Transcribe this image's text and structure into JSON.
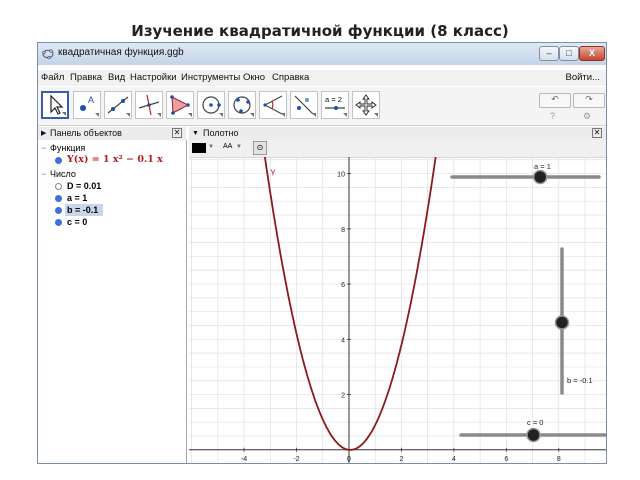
{
  "slide": {
    "title": "Изучение квадратичной функции (8 класс)"
  },
  "window": {
    "title": "квадратичная функция.ggb",
    "buttons": {
      "minimize": "–",
      "maximize": "□",
      "close": "X"
    }
  },
  "menu": {
    "items": [
      "Файл",
      "Правка",
      "Вид",
      "Настройки",
      "Инструменты",
      "Окно",
      "Справка"
    ],
    "login": "Войти..."
  },
  "toolbar": {
    "tools": [
      {
        "name": "move-tool-icon"
      },
      {
        "name": "point-tool-icon"
      },
      {
        "name": "line-tool-icon"
      },
      {
        "name": "perpendicular-tool-icon"
      },
      {
        "name": "polygon-tool-icon"
      },
      {
        "name": "circle-tool-icon"
      },
      {
        "name": "conic-tool-icon"
      },
      {
        "name": "angle-tool-icon"
      },
      {
        "name": "reflect-tool-icon"
      },
      {
        "name": "slider-tool-icon",
        "label": "a = 2"
      },
      {
        "name": "move-graphics-tool-icon"
      }
    ],
    "undo": "↶",
    "redo": "↷",
    "help": "?",
    "settings": "⚙"
  },
  "algebra": {
    "header": "Панель объектов",
    "groups": [
      {
        "label": "Функция",
        "items": [
          {
            "text": "Y(x) = 1 x² − 0.1 x",
            "filled": true,
            "color": "#b31b1b"
          }
        ]
      },
      {
        "label": "Число",
        "items": [
          {
            "text": "D = 0.01",
            "filled": false,
            "color": "#000000"
          },
          {
            "text": "a = 1",
            "filled": true,
            "color": "#000000"
          },
          {
            "text": "b = -0.1",
            "filled": true,
            "color": "#000000",
            "selected": true
          },
          {
            "text": "c = 0",
            "filled": true,
            "color": "#000000"
          }
        ]
      }
    ]
  },
  "graphics": {
    "header": "Полотно",
    "stylebar": {
      "color_swatch": "#000000",
      "text_style": "AA"
    },
    "function_label": "Y",
    "curve_color": "#8b1a1a",
    "x_ticks": [
      -4,
      -2,
      0,
      2,
      4,
      6,
      8
    ],
    "y_ticks": [
      2,
      4,
      6,
      8,
      10
    ],
    "xlim": [
      -6.1,
      9.8
    ],
    "ylim": [
      -0.55,
      10.6
    ],
    "sliders": [
      {
        "label": "a = 1",
        "orientation": "horizontal",
        "value": 1,
        "min": -5,
        "max": 5
      },
      {
        "label": "b = -0.1",
        "orientation": "vertical",
        "value": -0.1,
        "min": -5,
        "max": 5
      },
      {
        "label": "c = 0",
        "orientation": "horizontal",
        "value": 0,
        "min": -5,
        "max": 5
      }
    ]
  }
}
